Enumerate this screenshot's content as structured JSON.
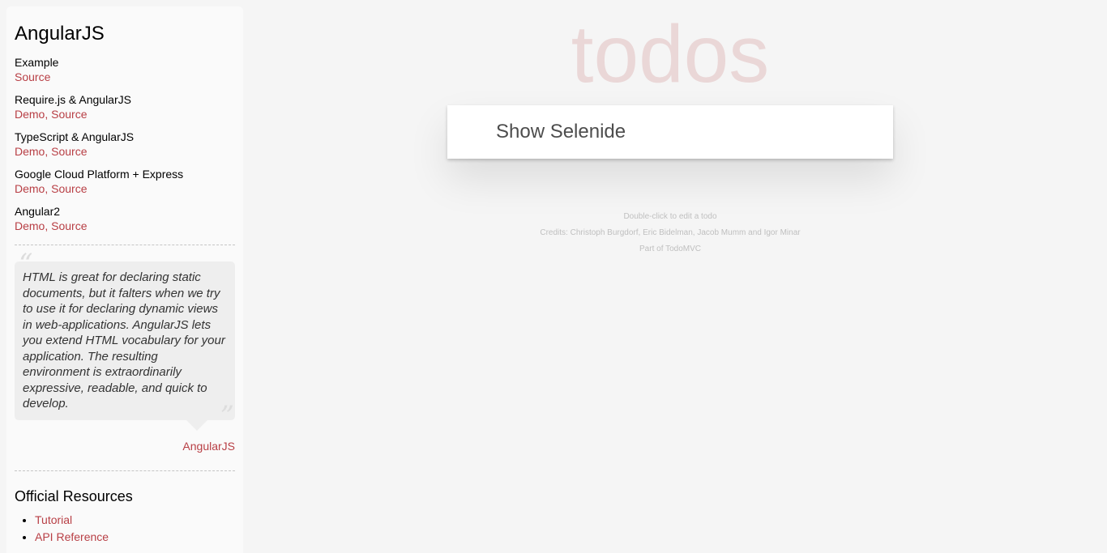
{
  "sidebar": {
    "title": "AngularJS",
    "examples": [
      {
        "name": "Example",
        "links": [
          {
            "label": "Source"
          }
        ]
      },
      {
        "name": "Require.js & AngularJS",
        "links": [
          {
            "label": "Demo"
          },
          {
            "label": "Source"
          }
        ]
      },
      {
        "name": "TypeScript & AngularJS",
        "links": [
          {
            "label": "Demo"
          },
          {
            "label": "Source"
          }
        ]
      },
      {
        "name": "Google Cloud Platform + Express",
        "links": [
          {
            "label": "Demo"
          },
          {
            "label": "Source"
          }
        ]
      },
      {
        "name": "Angular2",
        "links": [
          {
            "label": "Demo"
          },
          {
            "label": "Source"
          }
        ]
      }
    ],
    "separator": ", ",
    "quote": {
      "open_mark": "“",
      "close_mark": "”",
      "text": "HTML is great for declaring static documents, but it falters when we try to use it for declaring dynamic views in web-applications. AngularJS lets you extend HTML vocabulary for your application. The resulting environment is extraordinarily expressive, readable, and quick to develop.",
      "attribution": "AngularJS"
    },
    "resources": {
      "heading": "Official Resources",
      "items": [
        {
          "label": "Tutorial"
        },
        {
          "label": "API Reference"
        }
      ]
    }
  },
  "app": {
    "title": "todos",
    "new_todo_value": "Show Selenide"
  },
  "footer": {
    "line1": "Double-click to edit a todo",
    "line2": "Credits: Christoph Burgdorf, Eric Bidelman, Jacob Mumm and Igor Minar",
    "line3": "Part of TodoMVC"
  },
  "colors": {
    "accent": "#b83f45",
    "background": "#f5f5f5",
    "sidebar": "#fafafa",
    "title": "rgba(175, 47, 47, 0.15)"
  }
}
